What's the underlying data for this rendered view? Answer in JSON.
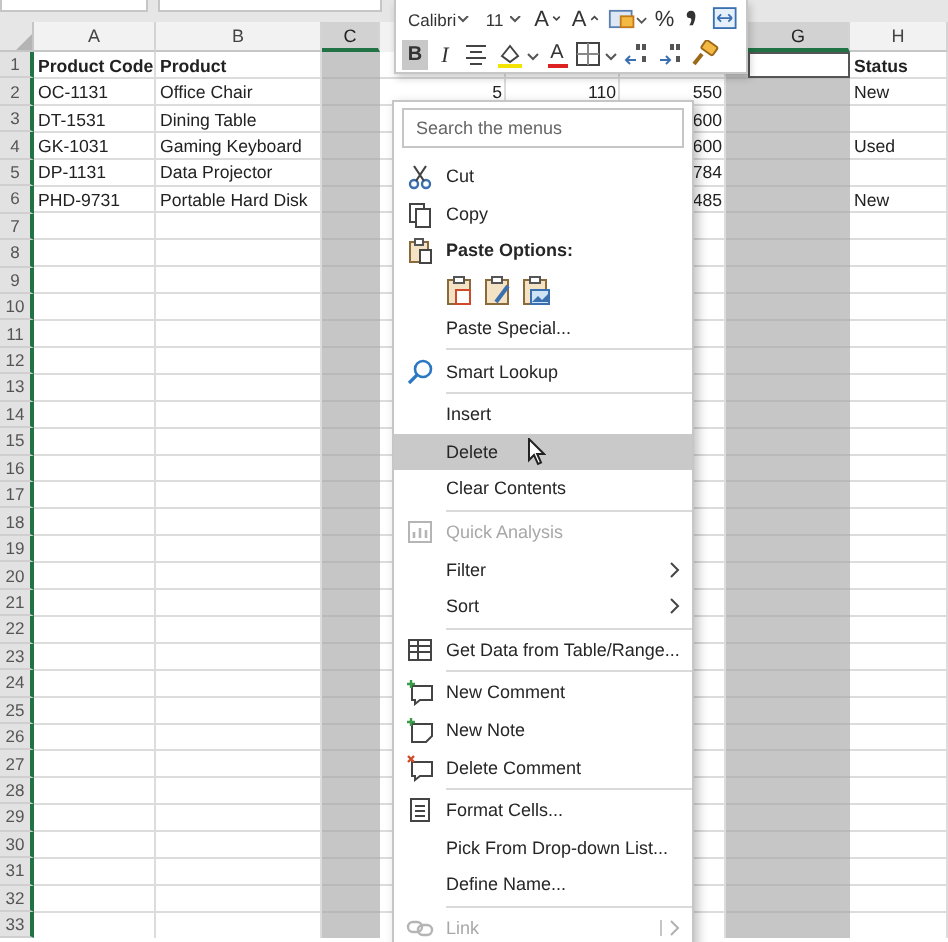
{
  "sheet": {
    "columns": [
      {
        "label": "A",
        "selected": false,
        "numeric": false
      },
      {
        "label": "B",
        "selected": false,
        "numeric": false
      },
      {
        "label": "C",
        "selected": true,
        "numeric": false
      },
      {
        "numeric": true
      },
      {
        "numeric": true
      },
      {
        "numeric": true
      },
      {
        "label": "G",
        "selected": true,
        "numeric": false
      },
      {
        "label": "H",
        "selected": false,
        "numeric": false
      }
    ],
    "rows": [
      {
        "number": "1",
        "header": true,
        "cells": [
          "Product Code",
          "Product",
          null,
          null,
          null,
          null,
          {
            "active": true
          },
          "Status"
        ]
      },
      {
        "number": "2",
        "header": false,
        "cells": [
          "OC-1131",
          "Office Chair",
          null,
          "5",
          "110",
          "550",
          null,
          "New"
        ]
      },
      {
        "number": "3",
        "header": false,
        "cells": [
          "DT-1531",
          "Dining Table",
          null,
          null,
          null,
          "600",
          null,
          null
        ]
      },
      {
        "number": "4",
        "header": false,
        "cells": [
          "GK-1031",
          "Gaming Keyboard",
          null,
          null,
          null,
          "600",
          null,
          "Used"
        ]
      },
      {
        "number": "5",
        "header": false,
        "cells": [
          "DP-1131",
          "Data Projector",
          null,
          null,
          null,
          "784",
          null,
          null
        ]
      },
      {
        "number": "6",
        "header": false,
        "cells": [
          "PHD-9731",
          "Portable Hard Disk",
          null,
          null,
          null,
          "485",
          null,
          "New"
        ]
      },
      {
        "number": "7"
      },
      {
        "number": "8"
      },
      {
        "number": "9"
      },
      {
        "number": "10"
      },
      {
        "number": "11"
      },
      {
        "number": "12"
      },
      {
        "number": "13"
      },
      {
        "number": "14"
      },
      {
        "number": "15"
      },
      {
        "number": "16"
      },
      {
        "number": "17"
      },
      {
        "number": "18"
      },
      {
        "number": "19"
      },
      {
        "number": "20"
      },
      {
        "number": "21"
      },
      {
        "number": "22"
      },
      {
        "number": "23"
      },
      {
        "number": "24"
      },
      {
        "number": "25"
      },
      {
        "number": "26"
      },
      {
        "number": "27"
      },
      {
        "number": "28"
      },
      {
        "number": "29"
      },
      {
        "number": "30"
      },
      {
        "number": "31"
      },
      {
        "number": "32"
      },
      {
        "number": "33"
      }
    ]
  },
  "mini_toolbar": {
    "font_field": "Calibri",
    "size_field": "11",
    "rows": [
      [
        {
          "label": "A",
          "selected": false
        },
        {
          "label": "A",
          "selected": false
        },
        {
          "selected": false
        },
        {
          "label": "%",
          "selected": false
        },
        {
          "selected": false
        },
        {
          "selected": false
        }
      ],
      [
        {
          "label": "B",
          "selected": true
        },
        {
          "label": "I",
          "selected": false
        },
        {
          "selected": false
        },
        {
          "selected": false
        },
        {
          "label": "A",
          "selected": false
        },
        {
          "selected": false
        },
        {
          "selected": false
        },
        {
          "selected": false
        },
        {
          "selected": false
        }
      ]
    ]
  },
  "context_menu": {
    "items": [
      {
        "kind": "search",
        "placeholder": "Search the menus"
      },
      {
        "kind": "item",
        "label": "Cut",
        "selected": false,
        "disabled": false,
        "submenu": false
      },
      {
        "kind": "item",
        "label": "Copy",
        "selected": false,
        "disabled": false,
        "submenu": false
      },
      {
        "kind": "header",
        "label": "Paste Options:"
      },
      {
        "kind": "paste-icons"
      },
      {
        "kind": "item",
        "label": "Paste Special...",
        "selected": false,
        "disabled": false,
        "submenu": false
      },
      {
        "kind": "separator"
      },
      {
        "kind": "item",
        "label": "Smart Lookup",
        "selected": false,
        "disabled": false,
        "submenu": false
      },
      {
        "kind": "separator"
      },
      {
        "kind": "item",
        "label": "Insert",
        "selected": false,
        "disabled": false,
        "submenu": false
      },
      {
        "kind": "item",
        "label": "Delete",
        "selected": true,
        "disabled": false,
        "submenu": false
      },
      {
        "kind": "item",
        "label": "Clear Contents",
        "selected": false,
        "disabled": false,
        "submenu": false
      },
      {
        "kind": "separator"
      },
      {
        "kind": "item",
        "label": "Quick Analysis",
        "selected": false,
        "disabled": true,
        "submenu": false
      },
      {
        "kind": "item",
        "label": "Filter",
        "selected": false,
        "disabled": false,
        "submenu": true
      },
      {
        "kind": "item",
        "label": "Sort",
        "selected": false,
        "disabled": false,
        "submenu": true
      },
      {
        "kind": "separator"
      },
      {
        "kind": "item",
        "label": "Get Data from Table/Range...",
        "selected": false,
        "disabled": false,
        "submenu": false
      },
      {
        "kind": "separator"
      },
      {
        "kind": "item",
        "label": "New Comment",
        "selected": false,
        "disabled": false,
        "submenu": false
      },
      {
        "kind": "item",
        "label": "New Note",
        "selected": false,
        "disabled": false,
        "submenu": false
      },
      {
        "kind": "item",
        "label": "Delete Comment",
        "selected": false,
        "disabled": false,
        "submenu": false
      },
      {
        "kind": "separator"
      },
      {
        "kind": "item",
        "label": "Format Cells...",
        "selected": false,
        "disabled": false,
        "submenu": false
      },
      {
        "kind": "item",
        "label": "Pick From Drop-down List...",
        "selected": false,
        "disabled": false,
        "submenu": false
      },
      {
        "kind": "item",
        "label": "Define Name...",
        "selected": false,
        "disabled": false,
        "submenu": false
      },
      {
        "kind": "separator"
      },
      {
        "kind": "item",
        "label": "Link",
        "selected": false,
        "disabled": true,
        "submenu": true
      }
    ]
  }
}
